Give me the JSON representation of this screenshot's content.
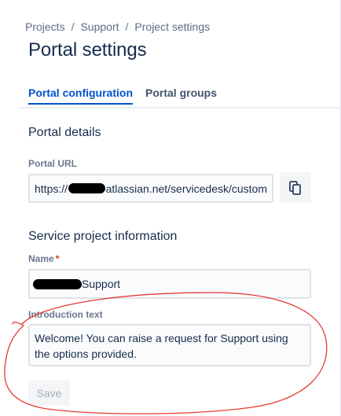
{
  "breadcrumb": {
    "items": [
      "Projects",
      "Support",
      "Project settings"
    ],
    "separator": "/"
  },
  "page": {
    "title": "Portal settings"
  },
  "tabs": [
    {
      "label": "Portal configuration",
      "active": true
    },
    {
      "label": "Portal groups",
      "active": false
    }
  ],
  "portal_details": {
    "title": "Portal details",
    "url_label": "Portal URL",
    "url_prefix": "https://",
    "url_suffix": "atlassian.net/servicedesk/custom",
    "copy_icon": "copy-icon"
  },
  "service_project": {
    "title": "Service project information",
    "name_label": "Name",
    "required_mark": "*",
    "name_value": "Support",
    "intro_label": "Introduction text",
    "intro_value": "Welcome! You can raise a request for Support using the options provided.",
    "save_label": "Save"
  },
  "colors": {
    "accent": "#0052cc",
    "annotation": "#e53935",
    "required": "#de350b"
  }
}
